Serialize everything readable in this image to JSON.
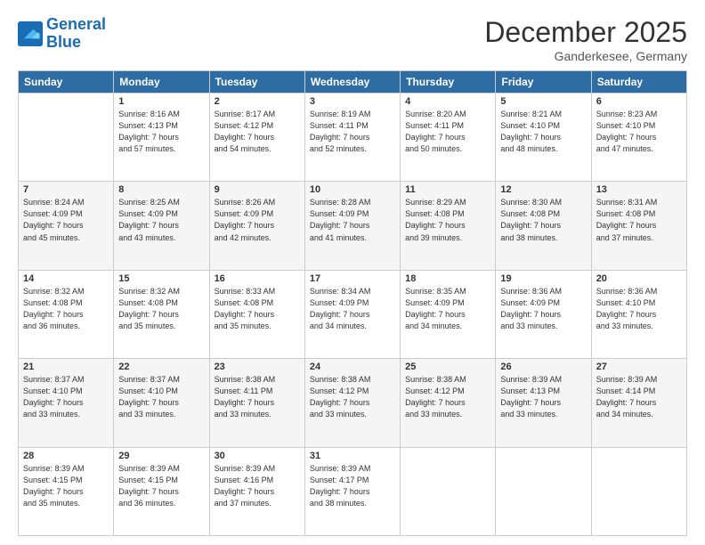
{
  "header": {
    "logo_line1": "General",
    "logo_line2": "Blue",
    "month": "December 2025",
    "location": "Ganderkesee, Germany"
  },
  "days_of_week": [
    "Sunday",
    "Monday",
    "Tuesday",
    "Wednesday",
    "Thursday",
    "Friday",
    "Saturday"
  ],
  "weeks": [
    [
      {
        "num": "",
        "detail": ""
      },
      {
        "num": "1",
        "detail": "Sunrise: 8:16 AM\nSunset: 4:13 PM\nDaylight: 7 hours\nand 57 minutes."
      },
      {
        "num": "2",
        "detail": "Sunrise: 8:17 AM\nSunset: 4:12 PM\nDaylight: 7 hours\nand 54 minutes."
      },
      {
        "num": "3",
        "detail": "Sunrise: 8:19 AM\nSunset: 4:11 PM\nDaylight: 7 hours\nand 52 minutes."
      },
      {
        "num": "4",
        "detail": "Sunrise: 8:20 AM\nSunset: 4:11 PM\nDaylight: 7 hours\nand 50 minutes."
      },
      {
        "num": "5",
        "detail": "Sunrise: 8:21 AM\nSunset: 4:10 PM\nDaylight: 7 hours\nand 48 minutes."
      },
      {
        "num": "6",
        "detail": "Sunrise: 8:23 AM\nSunset: 4:10 PM\nDaylight: 7 hours\nand 47 minutes."
      }
    ],
    [
      {
        "num": "7",
        "detail": "Sunrise: 8:24 AM\nSunset: 4:09 PM\nDaylight: 7 hours\nand 45 minutes."
      },
      {
        "num": "8",
        "detail": "Sunrise: 8:25 AM\nSunset: 4:09 PM\nDaylight: 7 hours\nand 43 minutes."
      },
      {
        "num": "9",
        "detail": "Sunrise: 8:26 AM\nSunset: 4:09 PM\nDaylight: 7 hours\nand 42 minutes."
      },
      {
        "num": "10",
        "detail": "Sunrise: 8:28 AM\nSunset: 4:09 PM\nDaylight: 7 hours\nand 41 minutes."
      },
      {
        "num": "11",
        "detail": "Sunrise: 8:29 AM\nSunset: 4:08 PM\nDaylight: 7 hours\nand 39 minutes."
      },
      {
        "num": "12",
        "detail": "Sunrise: 8:30 AM\nSunset: 4:08 PM\nDaylight: 7 hours\nand 38 minutes."
      },
      {
        "num": "13",
        "detail": "Sunrise: 8:31 AM\nSunset: 4:08 PM\nDaylight: 7 hours\nand 37 minutes."
      }
    ],
    [
      {
        "num": "14",
        "detail": "Sunrise: 8:32 AM\nSunset: 4:08 PM\nDaylight: 7 hours\nand 36 minutes."
      },
      {
        "num": "15",
        "detail": "Sunrise: 8:32 AM\nSunset: 4:08 PM\nDaylight: 7 hours\nand 35 minutes."
      },
      {
        "num": "16",
        "detail": "Sunrise: 8:33 AM\nSunset: 4:08 PM\nDaylight: 7 hours\nand 35 minutes."
      },
      {
        "num": "17",
        "detail": "Sunrise: 8:34 AM\nSunset: 4:09 PM\nDaylight: 7 hours\nand 34 minutes."
      },
      {
        "num": "18",
        "detail": "Sunrise: 8:35 AM\nSunset: 4:09 PM\nDaylight: 7 hours\nand 34 minutes."
      },
      {
        "num": "19",
        "detail": "Sunrise: 8:36 AM\nSunset: 4:09 PM\nDaylight: 7 hours\nand 33 minutes."
      },
      {
        "num": "20",
        "detail": "Sunrise: 8:36 AM\nSunset: 4:10 PM\nDaylight: 7 hours\nand 33 minutes."
      }
    ],
    [
      {
        "num": "21",
        "detail": "Sunrise: 8:37 AM\nSunset: 4:10 PM\nDaylight: 7 hours\nand 33 minutes."
      },
      {
        "num": "22",
        "detail": "Sunrise: 8:37 AM\nSunset: 4:10 PM\nDaylight: 7 hours\nand 33 minutes."
      },
      {
        "num": "23",
        "detail": "Sunrise: 8:38 AM\nSunset: 4:11 PM\nDaylight: 7 hours\nand 33 minutes."
      },
      {
        "num": "24",
        "detail": "Sunrise: 8:38 AM\nSunset: 4:12 PM\nDaylight: 7 hours\nand 33 minutes."
      },
      {
        "num": "25",
        "detail": "Sunrise: 8:38 AM\nSunset: 4:12 PM\nDaylight: 7 hours\nand 33 minutes."
      },
      {
        "num": "26",
        "detail": "Sunrise: 8:39 AM\nSunset: 4:13 PM\nDaylight: 7 hours\nand 33 minutes."
      },
      {
        "num": "27",
        "detail": "Sunrise: 8:39 AM\nSunset: 4:14 PM\nDaylight: 7 hours\nand 34 minutes."
      }
    ],
    [
      {
        "num": "28",
        "detail": "Sunrise: 8:39 AM\nSunset: 4:15 PM\nDaylight: 7 hours\nand 35 minutes."
      },
      {
        "num": "29",
        "detail": "Sunrise: 8:39 AM\nSunset: 4:15 PM\nDaylight: 7 hours\nand 36 minutes."
      },
      {
        "num": "30",
        "detail": "Sunrise: 8:39 AM\nSunset: 4:16 PM\nDaylight: 7 hours\nand 37 minutes."
      },
      {
        "num": "31",
        "detail": "Sunrise: 8:39 AM\nSunset: 4:17 PM\nDaylight: 7 hours\nand 38 minutes."
      },
      {
        "num": "",
        "detail": ""
      },
      {
        "num": "",
        "detail": ""
      },
      {
        "num": "",
        "detail": ""
      }
    ]
  ]
}
